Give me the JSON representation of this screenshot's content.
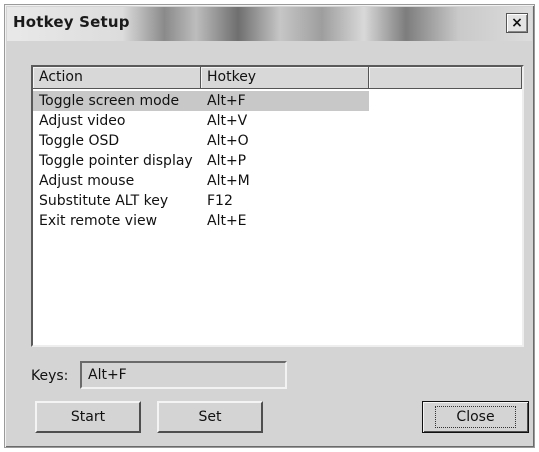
{
  "window": {
    "title": "Hotkey Setup",
    "close_glyph": "✕"
  },
  "list": {
    "columns": [
      "Action",
      "Hotkey",
      ""
    ],
    "rows": [
      {
        "action": "Toggle screen mode",
        "hotkey": "Alt+F",
        "selected": true
      },
      {
        "action": "Adjust video",
        "hotkey": "Alt+V",
        "selected": false
      },
      {
        "action": "Toggle OSD",
        "hotkey": "Alt+O",
        "selected": false
      },
      {
        "action": "Toggle pointer display",
        "hotkey": "Alt+P",
        "selected": false
      },
      {
        "action": "Adjust mouse",
        "hotkey": "Alt+M",
        "selected": false
      },
      {
        "action": "Substitute ALT key",
        "hotkey": "F12",
        "selected": false
      },
      {
        "action": "Exit remote view",
        "hotkey": "Alt+E",
        "selected": false
      }
    ]
  },
  "keys": {
    "label": "Keys:",
    "value": "Alt+F"
  },
  "buttons": {
    "start": "Start",
    "set": "Set",
    "close": "Close"
  }
}
